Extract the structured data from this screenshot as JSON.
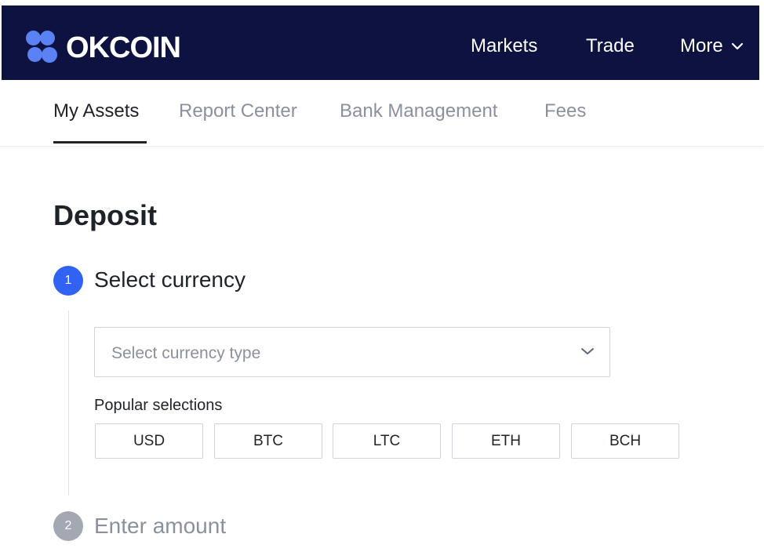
{
  "header": {
    "logo_text": "OKCOIN",
    "nav": {
      "markets": "Markets",
      "trade": "Trade",
      "more": "More"
    }
  },
  "subtabs": [
    {
      "label": "My Assets",
      "active": true
    },
    {
      "label": "Report Center",
      "active": false
    },
    {
      "label": "Bank Management",
      "active": false
    },
    {
      "label": "Fees",
      "active": false
    }
  ],
  "page_title": "Deposit",
  "steps": [
    {
      "number": "1",
      "label": "Select currency",
      "active": true
    },
    {
      "number": "2",
      "label": "Enter amount",
      "active": false
    }
  ],
  "currency_select": {
    "placeholder": "Select currency type"
  },
  "popular": {
    "label": "Popular selections",
    "options": [
      "USD",
      "BTC",
      "LTC",
      "ETH",
      "BCH"
    ]
  },
  "colors": {
    "header_bg": "#0d1240",
    "accent": "#3162f4",
    "logo_dots": "#5a82f5",
    "inactive_step": "#a3a8b2"
  }
}
